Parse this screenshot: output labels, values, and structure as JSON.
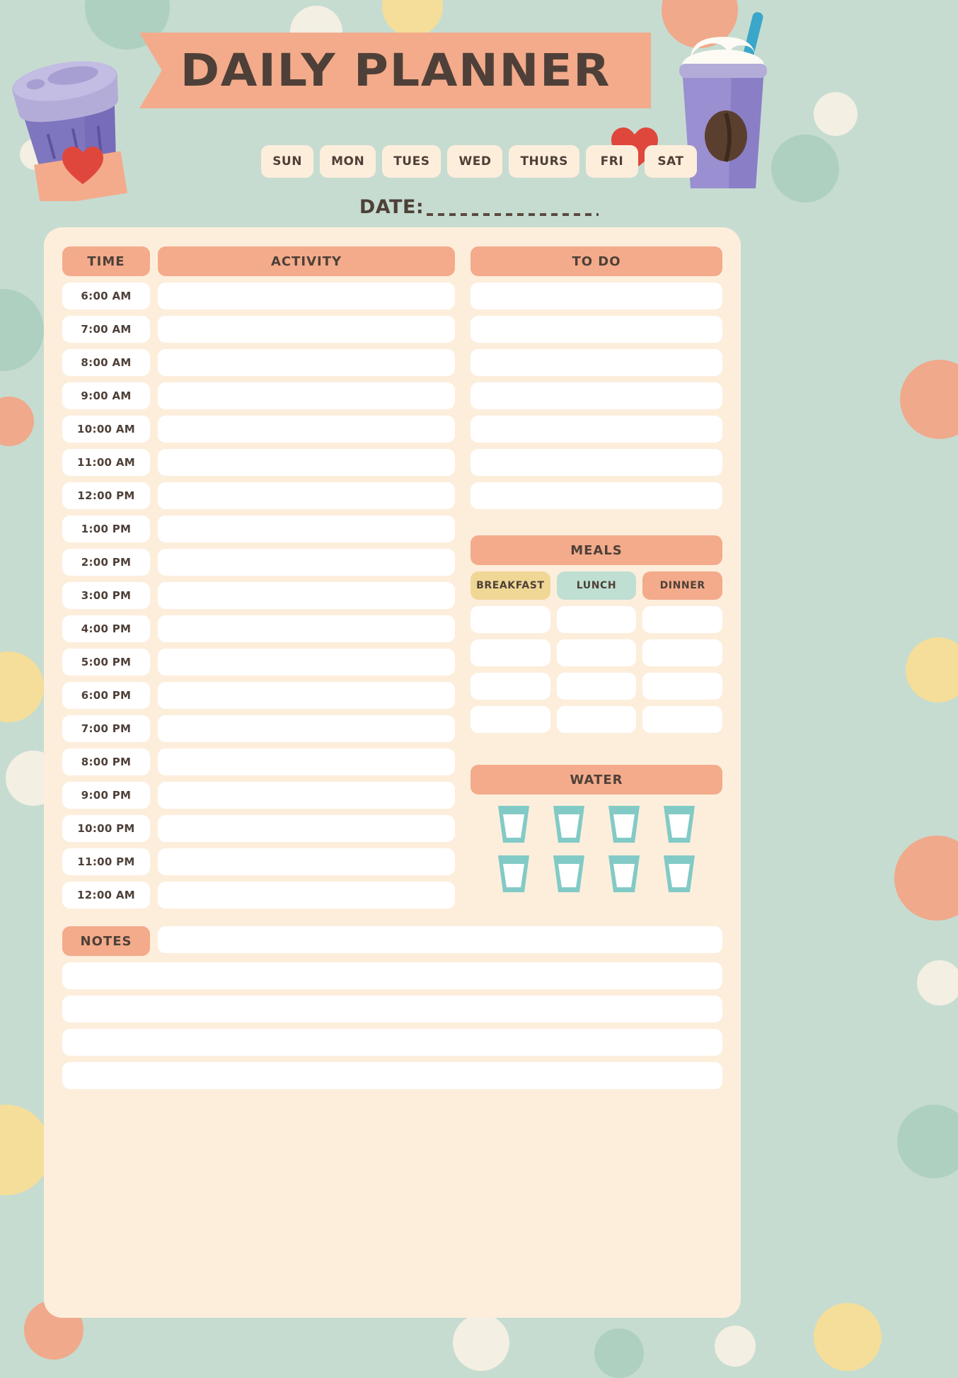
{
  "header": {
    "title": "DAILY PLANNER",
    "date_label": "DATE:",
    "days": [
      "SUN",
      "MON",
      "TUES",
      "WED",
      "THURS",
      "FRI",
      "SAT"
    ]
  },
  "schedule": {
    "time_header": "TIME",
    "activity_header": "ACTIVITY",
    "times": [
      "6:00 AM",
      "7:00 AM",
      "8:00 AM",
      "9:00 AM",
      "10:00 AM",
      "11:00 AM",
      "12:00 PM",
      "1:00 PM",
      "2:00 PM",
      "3:00 PM",
      "4:00 PM",
      "5:00 PM",
      "6:00 PM",
      "7:00 PM",
      "8:00 PM",
      "9:00 PM",
      "10:00 PM",
      "11:00 PM",
      "12:00 AM"
    ],
    "activities": [
      "",
      "",
      "",
      "",
      "",
      "",
      "",
      "",
      "",
      "",
      "",
      "",
      "",
      "",
      "",
      "",
      "",
      "",
      ""
    ]
  },
  "todo": {
    "header": "TO DO",
    "items": [
      "",
      "",
      "",
      "",
      "",
      "",
      ""
    ]
  },
  "meals": {
    "header": "MEALS",
    "columns": [
      {
        "label": "BREAKFAST",
        "color": "#f0d795",
        "entries": [
          "",
          "",
          "",
          ""
        ]
      },
      {
        "label": "LUNCH",
        "color": "#bfdfd2",
        "entries": [
          "",
          "",
          "",
          ""
        ]
      },
      {
        "label": "DINNER",
        "color": "#f3ab8b",
        "entries": [
          "",
          "",
          "",
          ""
        ]
      }
    ]
  },
  "water": {
    "header": "WATER",
    "glass_count": 8,
    "glasses_per_row": 4,
    "glass_color": "#82cac6",
    "filled": [
      false,
      false,
      false,
      false,
      false,
      false,
      false,
      false
    ]
  },
  "notes": {
    "header": "NOTES",
    "lines": [
      "",
      "",
      "",
      "",
      ""
    ]
  },
  "colors": {
    "background": "#c6dcd1",
    "card": "#fdeedc",
    "accent": "#f3ab8b",
    "text": "#4e4038",
    "pill": "#fdeedc",
    "heart": "#e0473c",
    "cup_purple": "#7f76c0",
    "cup_lid": "#b3acd9",
    "straw": "#3aa6c9"
  },
  "decorations": {
    "left_illustration": "coffee-cup-to-go",
    "right_illustration": "frappe-drink",
    "hearts": 2
  }
}
